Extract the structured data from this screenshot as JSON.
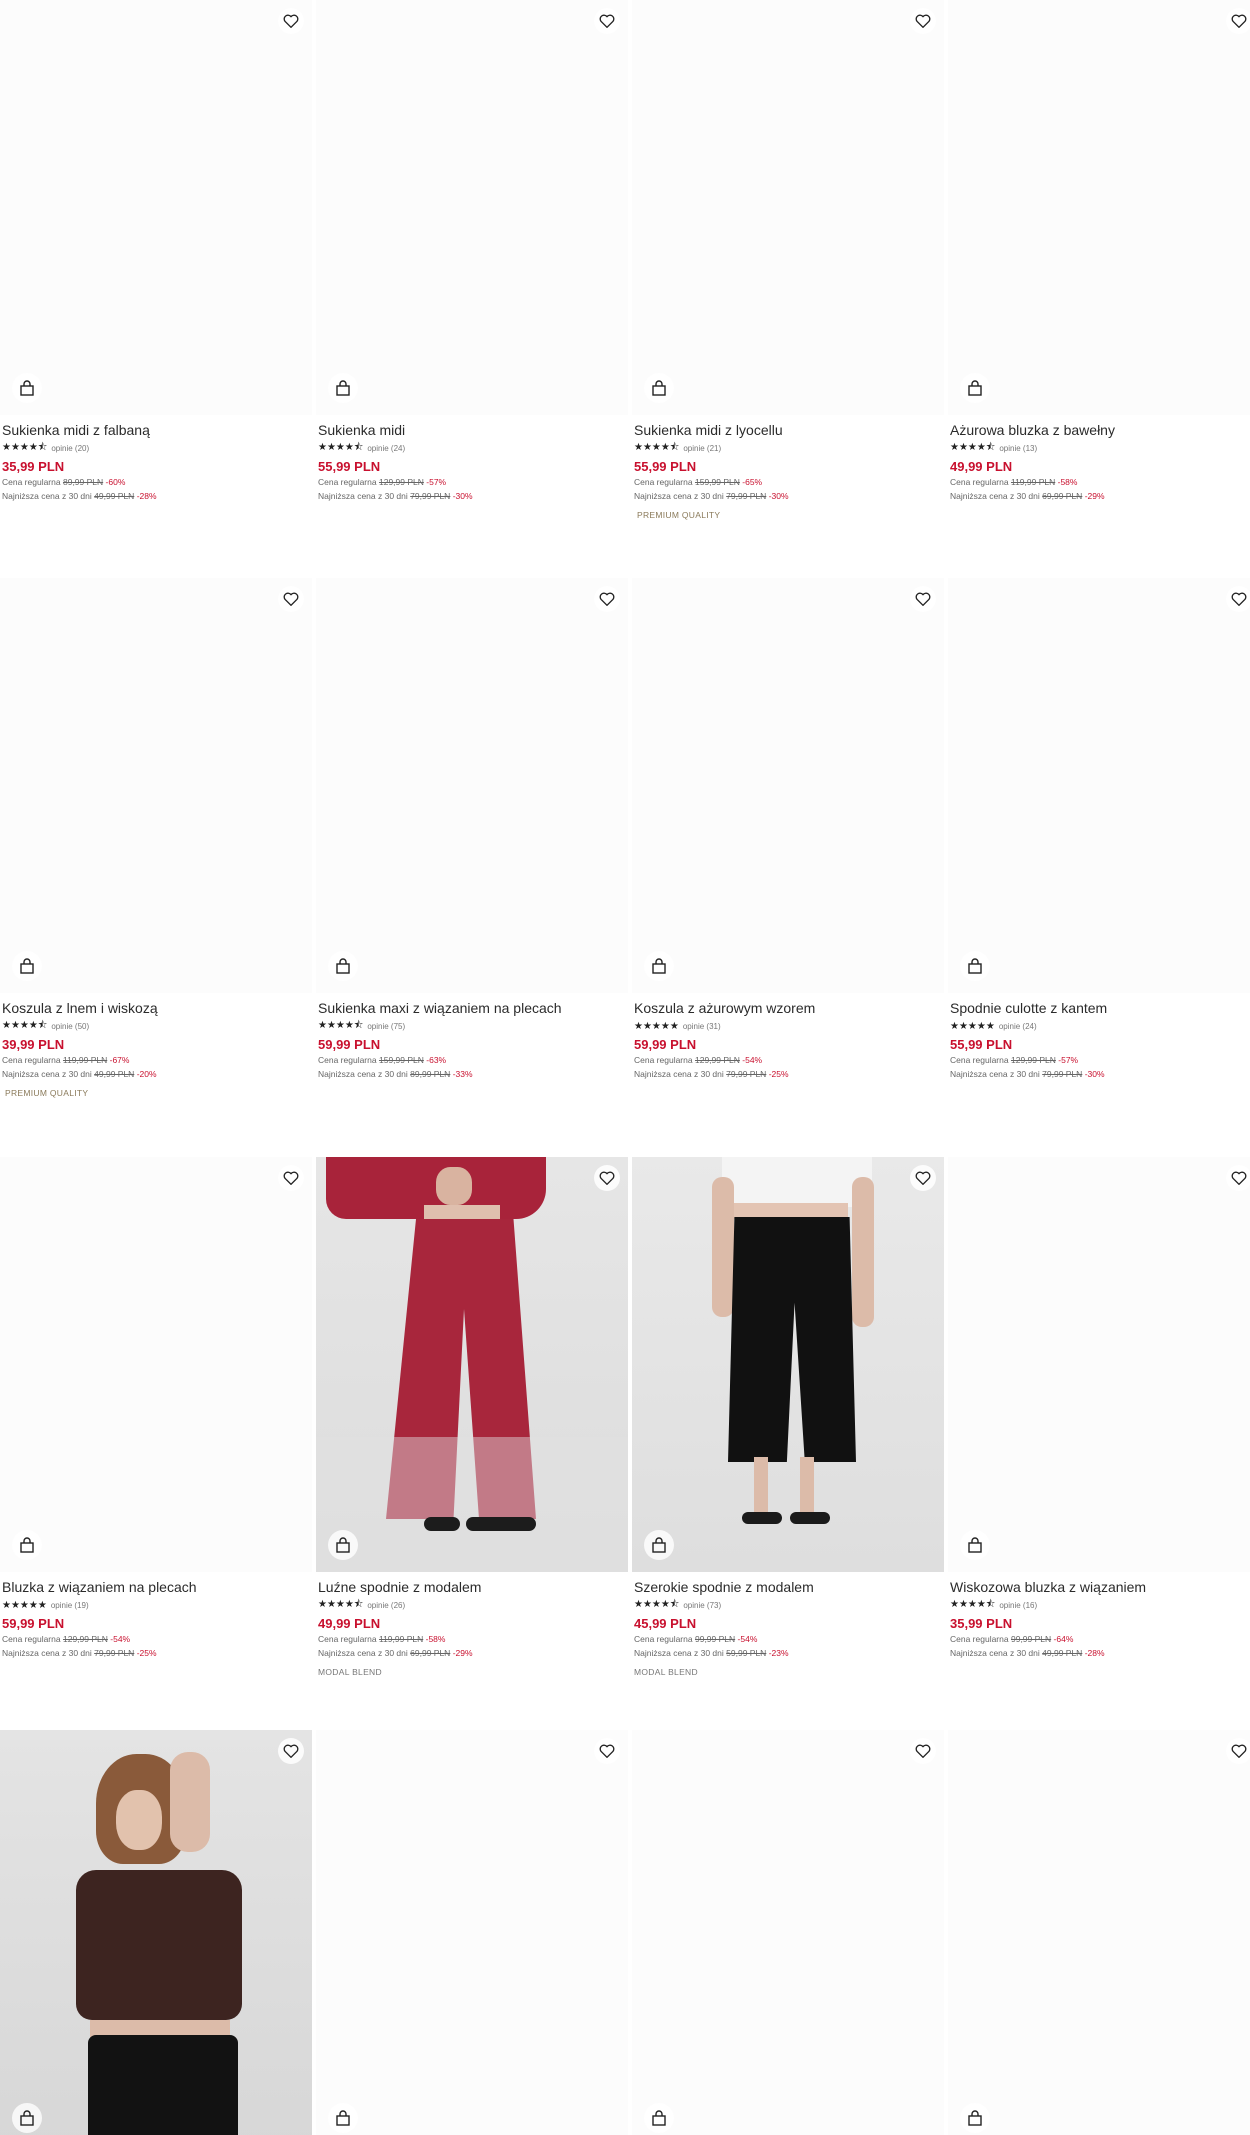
{
  "colors": {
    "price": "#c8102e",
    "text": "#2b2b2b",
    "muted": "#666666"
  },
  "labels": {
    "regular": "Cena regularna",
    "lowest30": "Najniższa cena z 30 dni"
  },
  "products": [
    {
      "title": "Sukienka midi z falbaną",
      "stars": "★★★★⯪",
      "opinions": "opinie (20)",
      "price": "35,99 PLN",
      "regular_old": "89,99 PLN",
      "regular_disc": "-60%",
      "low_old": "49,99 PLN",
      "low_disc": "-28%",
      "tag": ""
    },
    {
      "title": "Sukienka midi",
      "stars": "★★★★⯪",
      "opinions": "opinie (24)",
      "price": "55,99 PLN",
      "regular_old": "129,99 PLN",
      "regular_disc": "-57%",
      "low_old": "79,99 PLN",
      "low_disc": "-30%",
      "tag": ""
    },
    {
      "title": "Sukienka midi z lyocellu",
      "stars": "★★★★⯪",
      "opinions": "opinie (21)",
      "price": "55,99 PLN",
      "regular_old": "159,99 PLN",
      "regular_disc": "-65%",
      "low_old": "79,99 PLN",
      "low_disc": "-30%",
      "tag": "PREMIUM QUALITY"
    },
    {
      "title": "Ażurowa bluzka z bawełny",
      "stars": "★★★★⯪",
      "opinions": "opinie (13)",
      "price": "49,99 PLN",
      "regular_old": "119,99 PLN",
      "regular_disc": "-58%",
      "low_old": "69,99 PLN",
      "low_disc": "-29%",
      "tag": ""
    },
    {
      "title": "Koszula z lnem i wiskozą",
      "stars": "★★★★⯪",
      "opinions": "opinie (50)",
      "price": "39,99 PLN",
      "regular_old": "119,99 PLN",
      "regular_disc": "-67%",
      "low_old": "49,99 PLN",
      "low_disc": "-20%",
      "tag": "PREMIUM QUALITY"
    },
    {
      "title": "Sukienka maxi z wiązaniem na plecach",
      "stars": "★★★★⯪",
      "opinions": "opinie (75)",
      "price": "59,99 PLN",
      "regular_old": "159,99 PLN",
      "regular_disc": "-63%",
      "low_old": "89,99 PLN",
      "low_disc": "-33%",
      "tag": ""
    },
    {
      "title": "Koszula z ażurowym wzorem",
      "stars": "★★★★★",
      "opinions": "opinie (31)",
      "price": "59,99 PLN",
      "regular_old": "129,99 PLN",
      "regular_disc": "-54%",
      "low_old": "79,99 PLN",
      "low_disc": "-25%",
      "tag": ""
    },
    {
      "title": "Spodnie culotte z kantem",
      "stars": "★★★★★",
      "opinions": "opinie (24)",
      "price": "55,99 PLN",
      "regular_old": "129,99 PLN",
      "regular_disc": "-57%",
      "low_old": "79,99 PLN",
      "low_disc": "-30%",
      "tag": ""
    },
    {
      "title": "Bluzka z wiązaniem na plecach",
      "stars": "★★★★★",
      "opinions": "opinie (19)",
      "price": "59,99 PLN",
      "regular_old": "129,99 PLN",
      "regular_disc": "-54%",
      "low_old": "79,99 PLN",
      "low_disc": "-25%",
      "tag": ""
    },
    {
      "title": "Luźne spodnie z modalem",
      "stars": "★★★★⯪",
      "opinions": "opinie (26)",
      "price": "49,99 PLN",
      "regular_old": "119,99 PLN",
      "regular_disc": "-58%",
      "low_old": "69,99 PLN",
      "low_disc": "-29%",
      "tag": "MODAL BLEND"
    },
    {
      "title": "Szerokie spodnie z modalem",
      "stars": "★★★★⯪",
      "opinions": "opinie (73)",
      "price": "45,99 PLN",
      "regular_old": "99,99 PLN",
      "regular_disc": "-54%",
      "low_old": "59,99 PLN",
      "low_disc": "-23%",
      "tag": "MODAL BLEND"
    },
    {
      "title": "Wiskozowa bluzka z wiązaniem",
      "stars": "★★★★⯪",
      "opinions": "opinie (16)",
      "price": "35,99 PLN",
      "regular_old": "99,99 PLN",
      "regular_disc": "-64%",
      "low_old": "49,99 PLN",
      "low_disc": "-28%",
      "tag": ""
    }
  ],
  "row4": [
    {
      "image": "photo-brown-top"
    },
    {
      "image": "blank"
    },
    {
      "image": "blank"
    },
    {
      "image": "blank"
    }
  ]
}
